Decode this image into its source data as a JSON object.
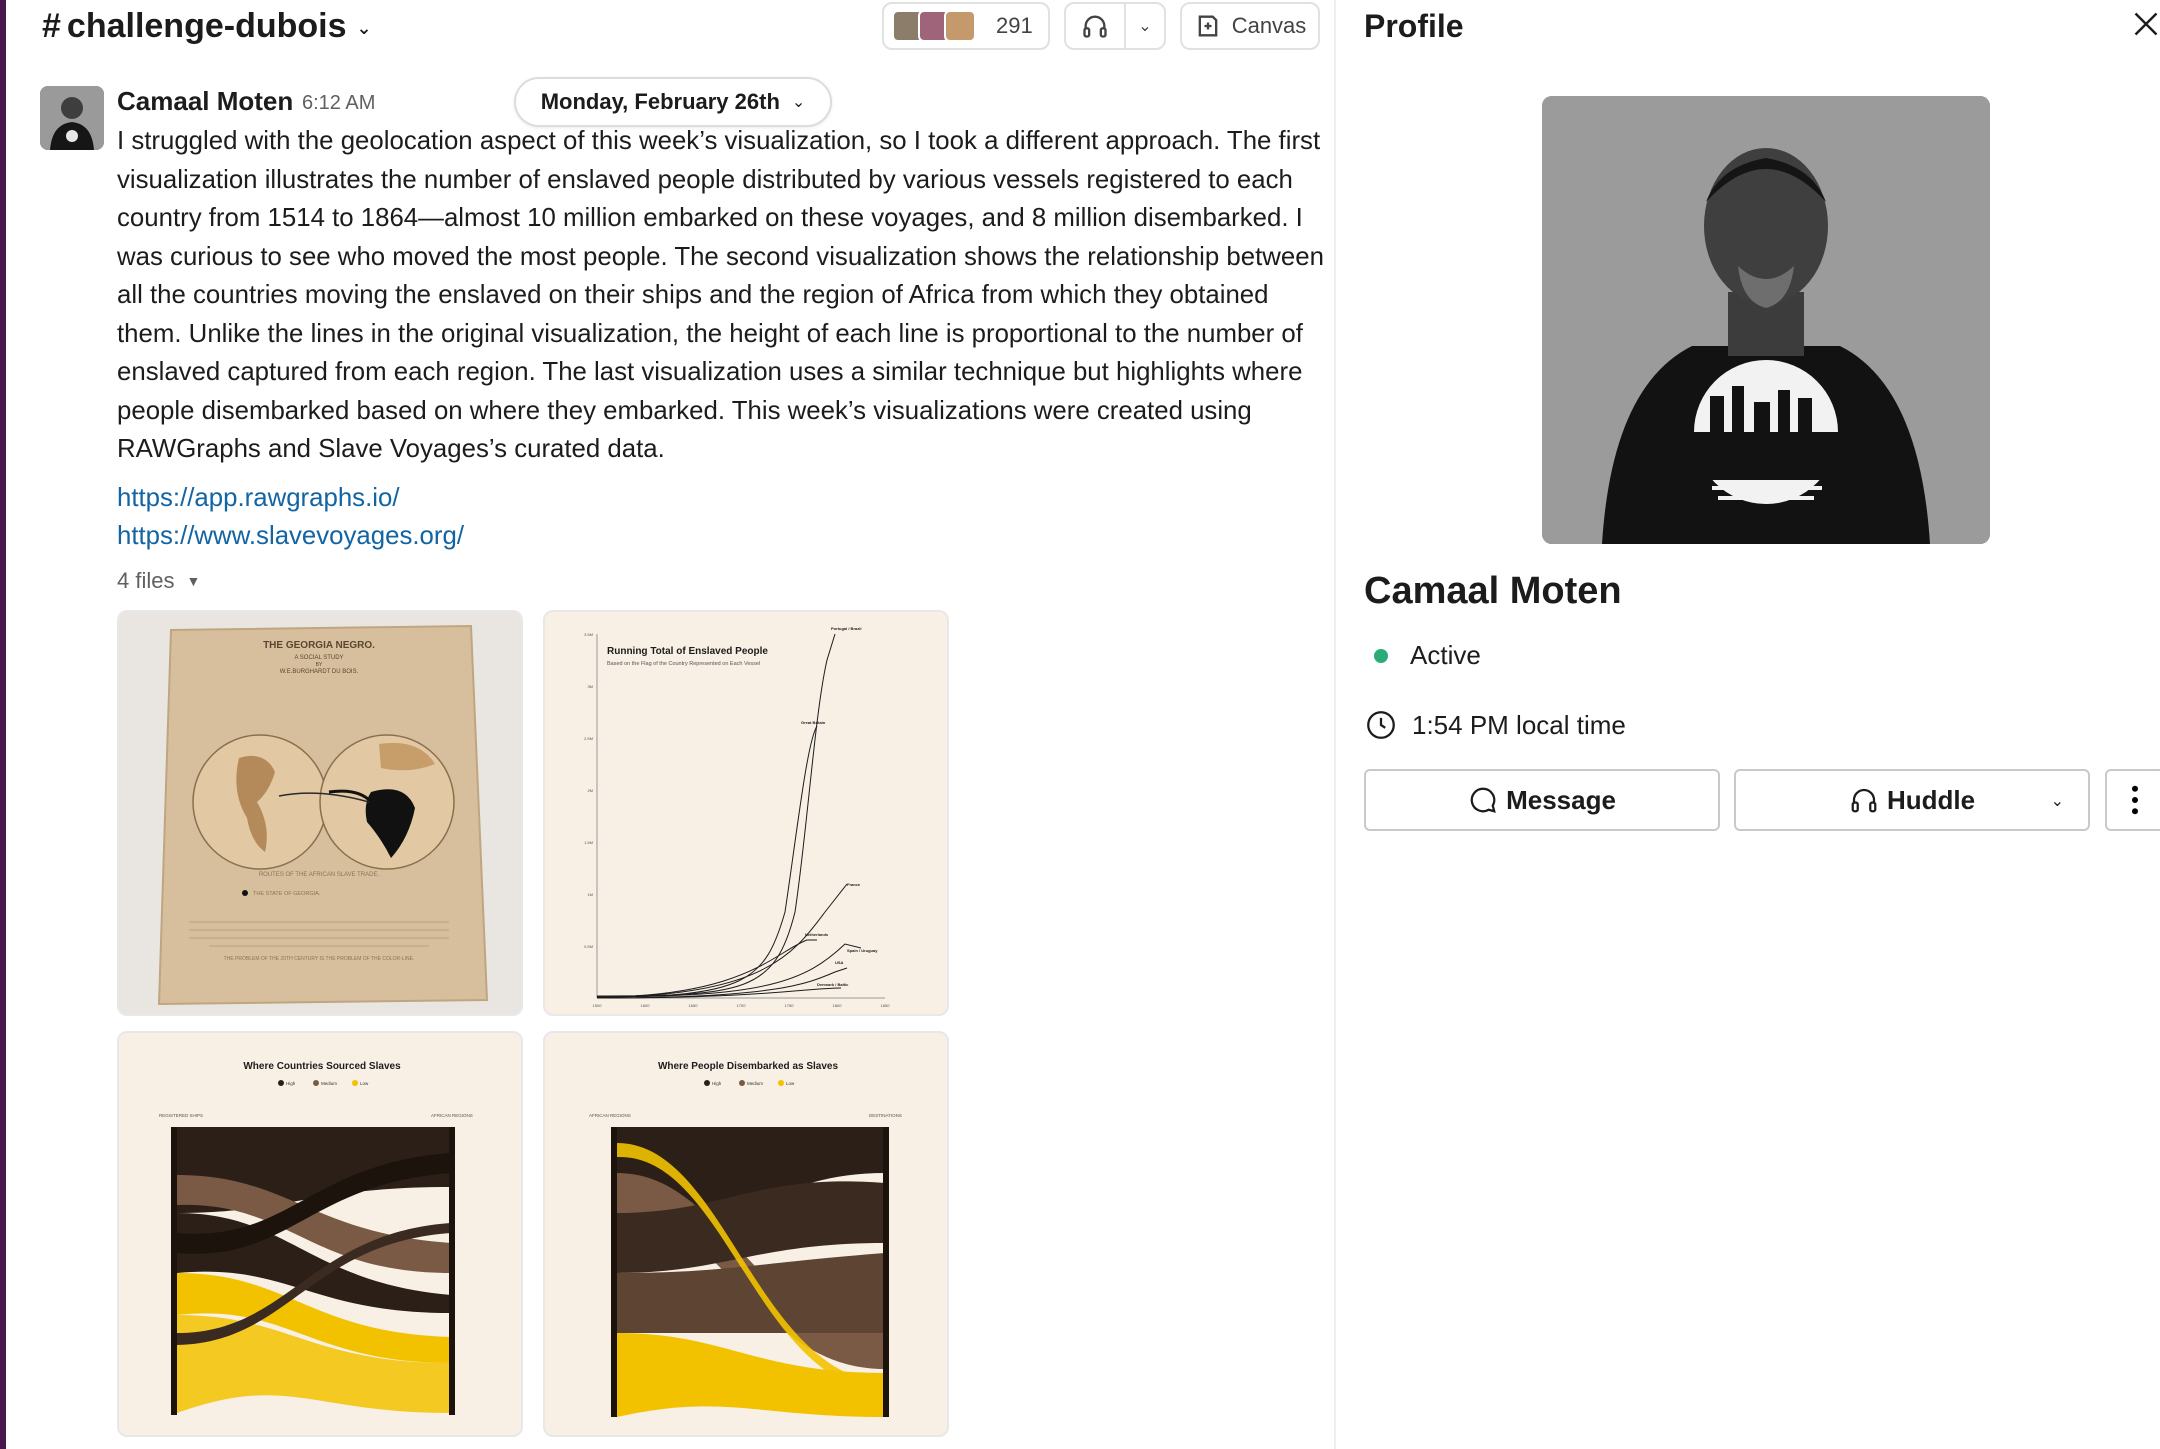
{
  "channel": {
    "name": "challenge-dubois",
    "hash": "#",
    "member_count": "291",
    "canvas_label": "Canvas"
  },
  "message": {
    "author": "Camaal Moten",
    "time": "6:12 AM",
    "date_divider": "Monday, February 26th",
    "body": "I struggled with the geolocation aspect of this week’s visualization, so I took a different approach. The first visualization illustrates the number of enslaved people distributed by various vessels registered to each country from 1514 to 1864—almost 10 million embarked on these voyages, and 8 million disembarked. I was curious to see who moved the most people. The second visualization shows the relationship between all the countries moving the enslaved on their ships and the region of Africa from which they obtained them. Unlike the lines in the original visualization, the height of each line is proportional to the number of enslaved captured from each region. The last visualization uses a similar technique but highlights where people disembarked based on where they embarked. This week’s visualizations were created using RAWGraphs and Slave Voyages’s curated data.",
    "links": [
      "https://app.rawgraphs.io/",
      "https://www.slavevoyages.org/"
    ],
    "files_label": "4 files"
  },
  "attachments": {
    "dubois": {
      "title": "THE GEORGIA NEGRO.",
      "subtitle": "A SOCIAL STUDY",
      "by": "BY",
      "author": "W.E.BURGHARDT DU BOIS.",
      "caption": "ROUTES OF THE AFRICAN SLAVE TRADE.",
      "legend": "THE STATE OF GEORGIA.",
      "note": "THE PROBLEM OF THE 20TH CENTURY IS THE PROBLEM OF THE COLOR-LINE."
    },
    "running_total": {
      "title": "Running Total of Enslaved People",
      "subtitle": "Based on the Flag of the Country Represented on Each Vessel",
      "y_ticks": [
        "3.5M",
        "3M",
        "2.5M",
        "2M",
        "1.5M",
        "1M",
        "0.5M"
      ],
      "x_ticks": [
        "1500",
        "1600",
        "1650",
        "1700",
        "1750",
        "1800",
        "1850"
      ],
      "series": [
        "Portugal / Brazil",
        "Great Britain",
        "France",
        "Netherlands",
        "Spain / Uruguay",
        "USA",
        "Denmark / Baltic"
      ]
    },
    "sourced": {
      "title": "Where Countries Sourced Slaves",
      "legend": [
        "High",
        "Medium",
        "Low"
      ],
      "left_heading": "REGISTERED SHIPS",
      "right_heading": "AFRICAN REGIONS"
    },
    "disembarked": {
      "title": "Where People Disembarked as Slaves",
      "legend": [
        "High",
        "Medium",
        "Low"
      ],
      "left_heading": "AFRICAN REGIONS",
      "right_heading": "DESTINATIONS"
    }
  },
  "profile": {
    "title": "Profile",
    "name": "Camaal Moten",
    "status": "Active",
    "local_time": "1:54 PM local time",
    "message_btn": "Message",
    "huddle_btn": "Huddle"
  },
  "colors": {
    "link": "#1264a3",
    "active": "#2bac76",
    "sankey_high": "#2b1f17",
    "sankey_medium": "#7a5a45",
    "sankey_low": "#f2c200"
  }
}
